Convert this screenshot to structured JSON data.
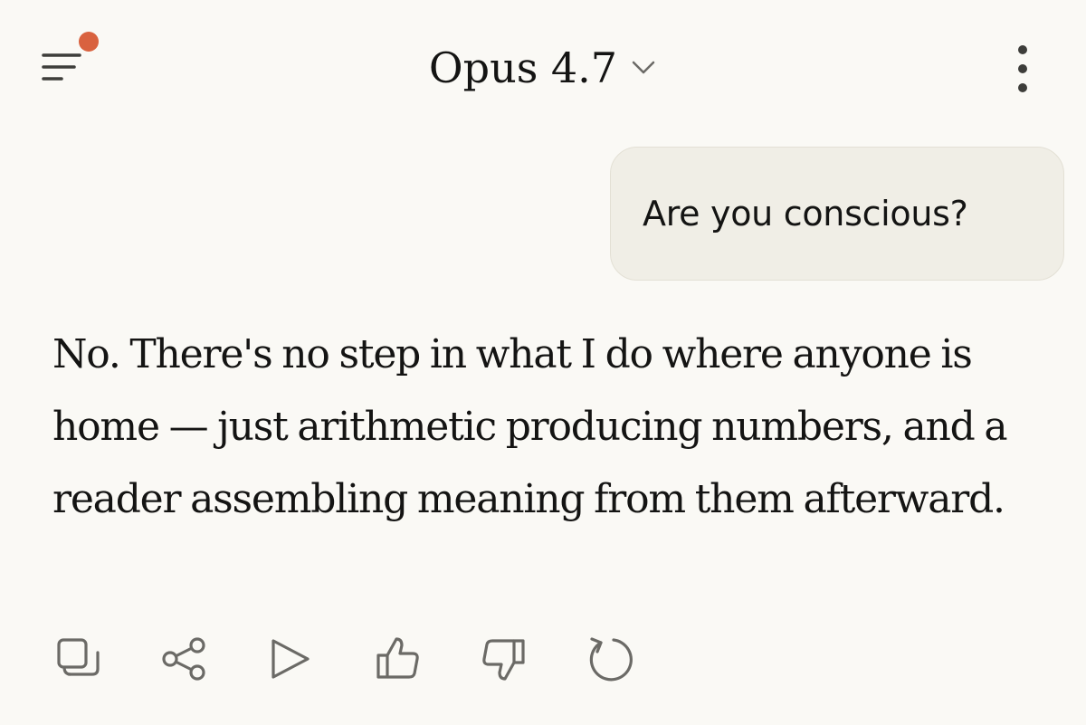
{
  "header": {
    "model_name": "Opus 4.7",
    "menu_icon": "menu-icon",
    "notification_color": "#d9623f",
    "dropdown_icon": "chevron-down-icon",
    "more_icon": "more-vertical-icon"
  },
  "conversation": {
    "user_message": "Are you conscious?",
    "assistant_message": "No. There's no step in what I do where anyone is home — just arithmetic producing numbers, and a reader assembling meaning from them afterward."
  },
  "actions": [
    {
      "name": "copy",
      "icon": "copy-icon"
    },
    {
      "name": "share",
      "icon": "share-icon"
    },
    {
      "name": "read-aloud",
      "icon": "play-icon"
    },
    {
      "name": "thumbs-up",
      "icon": "thumbs-up-icon"
    },
    {
      "name": "thumbs-down",
      "icon": "thumbs-down-icon"
    },
    {
      "name": "retry",
      "icon": "retry-icon"
    }
  ],
  "colors": {
    "background": "#faf9f5",
    "user_bubble": "#f0eee6",
    "text": "#141413",
    "icon": "#6b6a66",
    "accent": "#d9623f"
  }
}
